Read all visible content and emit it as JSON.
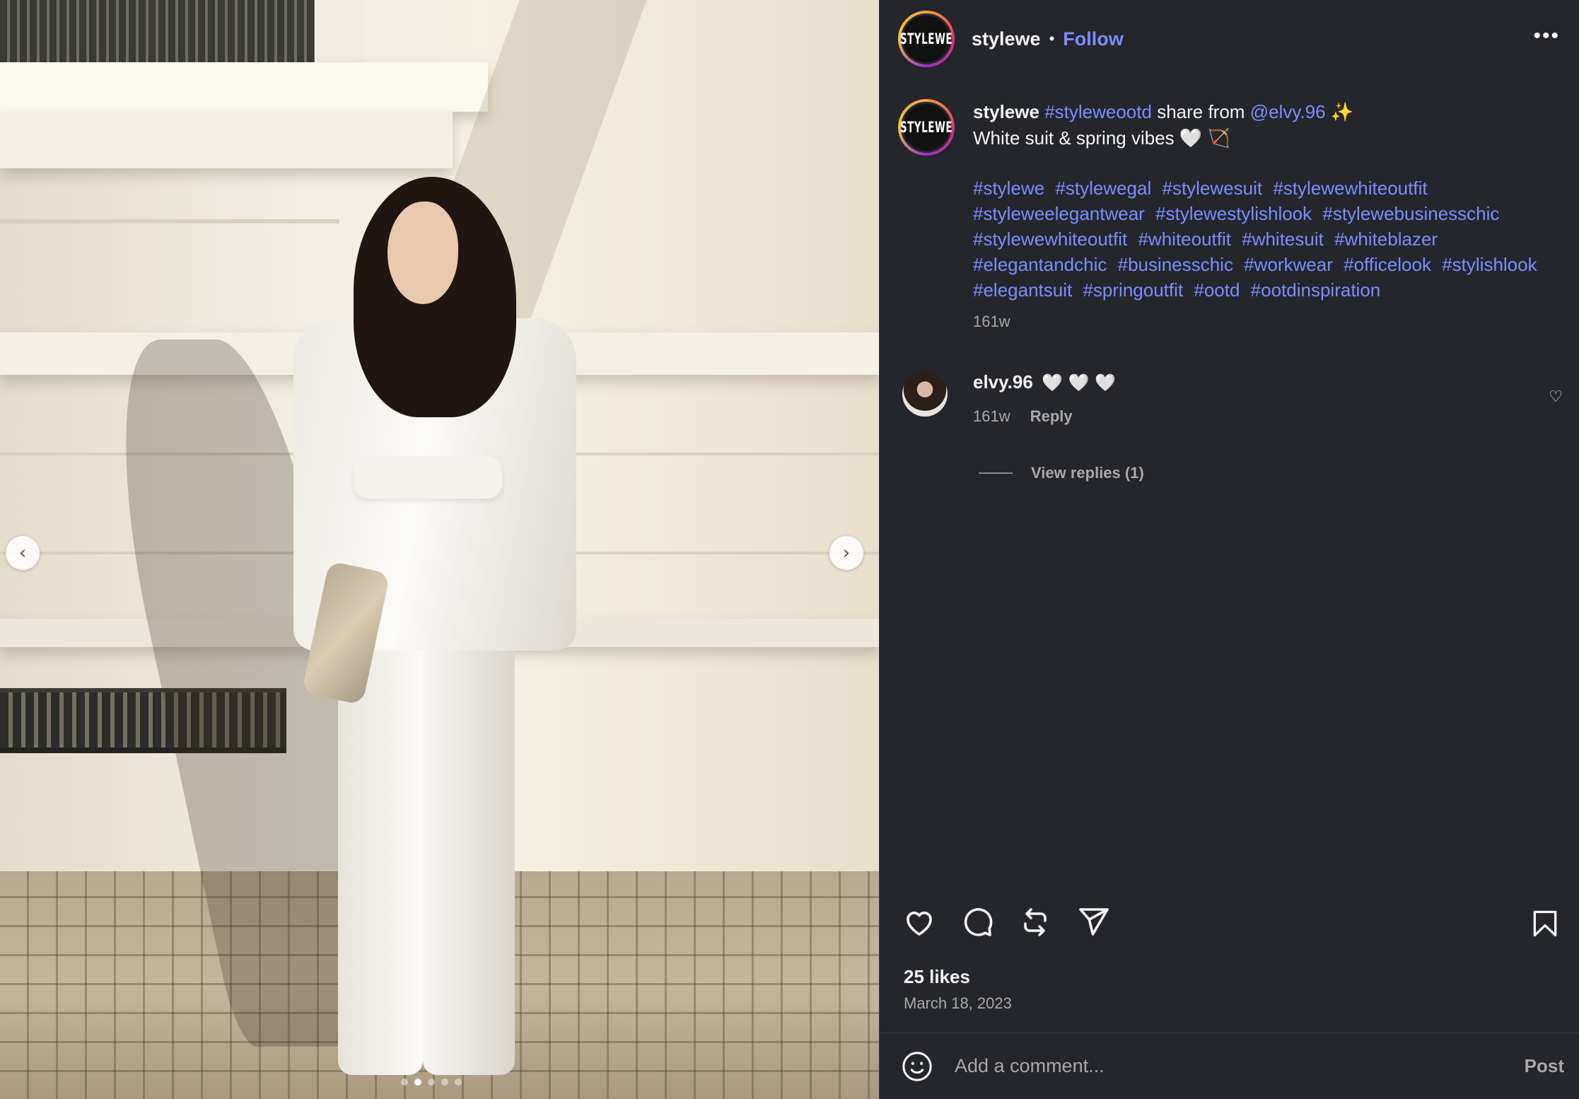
{
  "header": {
    "avatar_text": "STYLEWE",
    "username": "stylewe",
    "separator": "•",
    "follow_label": "Follow",
    "more_label": "•••"
  },
  "caption": {
    "avatar_text": "STYLEWE",
    "username": "stylewe",
    "hashtag_main": "#styleweootd",
    "share_text": "share from",
    "mention": "@elvy.96",
    "sparkle": "✨",
    "line2": "White suit & spring vibes 🤍 🏹",
    "hashtags": [
      "#stylewe",
      "#stylewegal",
      "#stylewesuit",
      "#stylewewhiteoutfit",
      "#styleweelegantwear",
      "#stylewestylishlook",
      "#stylewebusinesschic",
      "#stylewewhiteoutfit",
      "#whiteoutfit",
      "#whitesuit",
      "#whiteblazer",
      "#elegantandchic",
      "#businesschic",
      "#workwear",
      "#officelook",
      "#stylishlook",
      "#elegantsuit",
      "#springoutfit",
      "#ootd",
      "#ootdinspiration"
    ],
    "time": "161w"
  },
  "comment": {
    "username": "elvy.96",
    "text": "🤍 🤍 🤍",
    "time": "161w",
    "reply_label": "Reply",
    "like_icon": "♡",
    "view_replies": "View replies (1)"
  },
  "carousel": {
    "prev_label": "‹",
    "next_label": "›",
    "slide_count": 5,
    "active_slide": 2
  },
  "stats": {
    "likes": "25 likes",
    "date": "March 18, 2023"
  },
  "composer": {
    "placeholder": "Add a comment...",
    "post_label": "Post"
  },
  "colors": {
    "accent_link": "#7b8cff",
    "panel_bg": "#25262c",
    "muted_text": "#a8a8a8"
  }
}
